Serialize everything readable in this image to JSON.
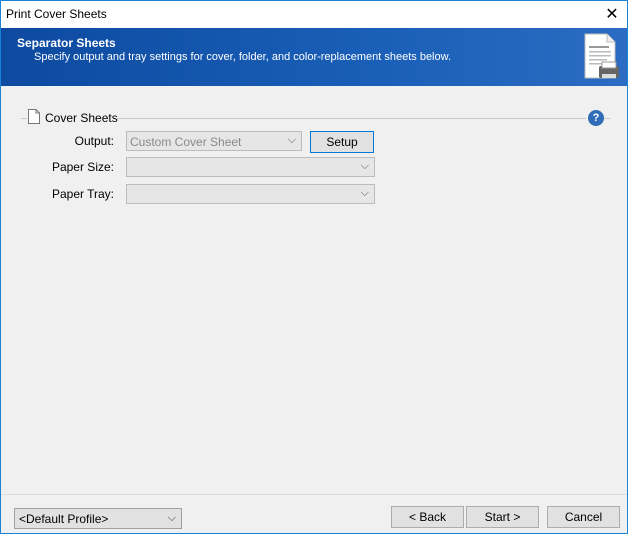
{
  "window": {
    "title": "Print Cover Sheets",
    "close_glyph": "✕"
  },
  "banner": {
    "title": "Separator Sheets",
    "subtitle": "Specify output and tray settings for cover, folder, and color-replacement sheets below.",
    "icon": "document-printer-icon"
  },
  "group": {
    "label": "Cover Sheets",
    "help_glyph": "?"
  },
  "fields": {
    "output": {
      "label": "Output:",
      "value": "Custom Cover Sheet"
    },
    "paper_size": {
      "label": "Paper Size:",
      "value": ""
    },
    "paper_tray": {
      "label": "Paper Tray:",
      "value": ""
    }
  },
  "buttons": {
    "setup": "Setup",
    "back": "< Back",
    "start": "Start >",
    "cancel": "Cancel"
  },
  "profile": {
    "value": "<Default Profile>"
  },
  "colors": {
    "banner": "#1a5fb8",
    "accent": "#0078d7"
  }
}
